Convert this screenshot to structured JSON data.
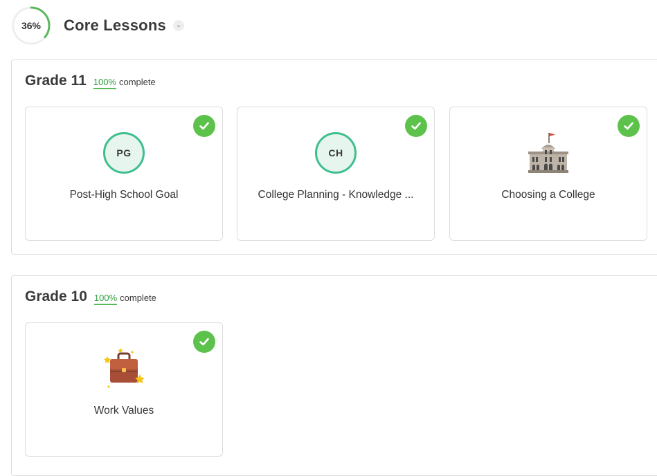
{
  "header": {
    "progress_text": "36%",
    "progress_value": 0.36,
    "title": "Core Lessons",
    "toggle_icon": "chevron-down-icon"
  },
  "colors": {
    "progress": "#5cb85c",
    "check": "#5cc24b",
    "badge_border": "#3fbf8e",
    "badge_fill": "#e6f5ee",
    "complete_text": "#2e9e3e"
  },
  "sections": [
    {
      "grade": "Grade 11",
      "percent": "100%",
      "status": "complete",
      "lessons": [
        {
          "badge": "PG",
          "title": "Post-High School Goal",
          "completed": true,
          "icon": "check-icon"
        },
        {
          "badge": "CH",
          "title": "College Planning - Knowledge ...",
          "completed": true,
          "icon": "check-icon"
        },
        {
          "title": "Choosing a College",
          "completed": true,
          "image": "college-building-icon",
          "icon": "check-icon"
        }
      ]
    },
    {
      "grade": "Grade 10",
      "percent": "100%",
      "status": "complete",
      "lessons": [
        {
          "title": "Work Values",
          "completed": true,
          "image": "briefcase-stars-icon",
          "icon": "check-icon"
        }
      ]
    }
  ]
}
